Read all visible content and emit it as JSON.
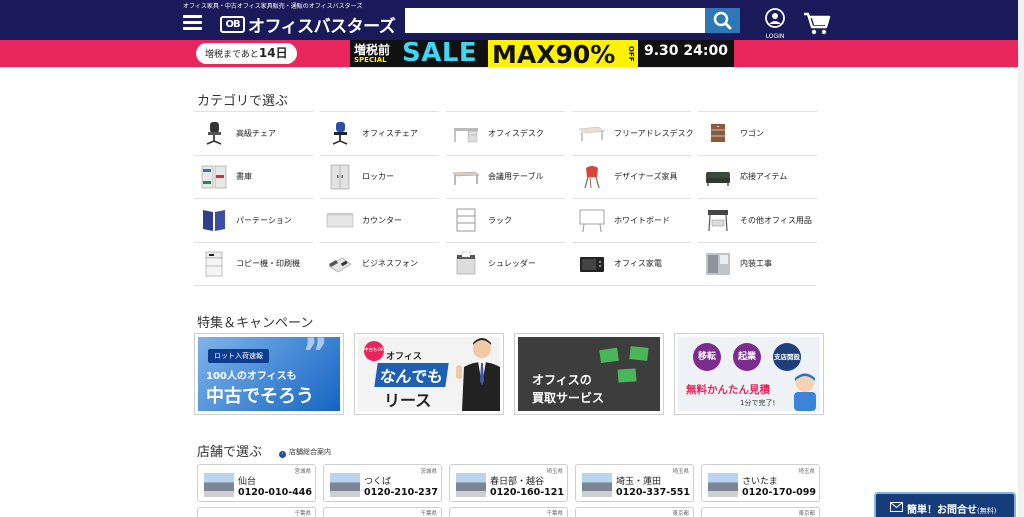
{
  "header": {
    "tagline": "オフィス家具・中古オフィス家具販売・通販のオフィスバスターズ",
    "logo_mark": "OB",
    "logo_text": "オフィスバスターズ",
    "search_placeholder": "",
    "login_label": "LOGIN"
  },
  "banner": {
    "countdown_prefix": "増税まであと",
    "countdown_days": "14日",
    "sale_pre": "増税前",
    "sale_special": "SPECIAL",
    "sale_word": "SALE",
    "sale_max": "MAX90%",
    "sale_off": "OFF",
    "sale_date": "9.30 24:00"
  },
  "categories": {
    "title": "カテゴリで選ぶ",
    "items": [
      {
        "label": "高級チェア",
        "icon": "chair-icon"
      },
      {
        "label": "オフィスチェア",
        "icon": "office-chair-icon"
      },
      {
        "label": "オフィスデスク",
        "icon": "desk-icon"
      },
      {
        "label": "フリーアドレスデスク",
        "icon": "free-address-desk-icon"
      },
      {
        "label": "ワゴン",
        "icon": "wagon-icon"
      },
      {
        "label": "書庫",
        "icon": "bookcase-icon"
      },
      {
        "label": "ロッカー",
        "icon": "locker-icon"
      },
      {
        "label": "会議用テーブル",
        "icon": "meeting-table-icon"
      },
      {
        "label": "デザイナーズ家具",
        "icon": "designer-chair-icon"
      },
      {
        "label": "応接アイテム",
        "icon": "sofa-icon"
      },
      {
        "label": "パーテーション",
        "icon": "partition-icon"
      },
      {
        "label": "カウンター",
        "icon": "counter-icon"
      },
      {
        "label": "ラック",
        "icon": "rack-icon"
      },
      {
        "label": "ホワイトボード",
        "icon": "whiteboard-icon"
      },
      {
        "label": "その他オフィス用品",
        "icon": "other-supplies-icon"
      },
      {
        "label": "コピー機・印刷機",
        "icon": "copier-icon"
      },
      {
        "label": "ビジネスフォン",
        "icon": "business-phone-icon"
      },
      {
        "label": "シュレッダー",
        "icon": "shredder-icon"
      },
      {
        "label": "オフィス家電",
        "icon": "appliance-icon"
      },
      {
        "label": "内装工事",
        "icon": "interior-work-icon"
      }
    ]
  },
  "campaigns": {
    "title": "特集＆キャンペーン",
    "c1": {
      "badge": "ロット入荷速報",
      "line1": "100人のオフィスも",
      "line2": "中古でそろう"
    },
    "c2": {
      "badge": "中古もOK!",
      "line1": "オフィス",
      "line2": "なんでも",
      "line3": "リース"
    },
    "c3": {
      "line1": "オフィスの",
      "line2": "買取サービス"
    },
    "c4": {
      "b1": "移転",
      "b2": "起業",
      "b3": "支店開設",
      "line1": "無料かんたん見積",
      "line2": "1分で完了!"
    }
  },
  "stores": {
    "title": "店舗で選ぶ",
    "guide_link": "店舗総合案内",
    "items": [
      {
        "pref": "宮城県",
        "name": "仙台",
        "phone": "0120-010-446"
      },
      {
        "pref": "茨城県",
        "name": "つくば",
        "phone": "0120-210-237"
      },
      {
        "pref": "埼玉県",
        "name": "春日部・越谷",
        "phone": "0120-160-121"
      },
      {
        "pref": "埼玉県",
        "name": "埼玉・蓮田",
        "phone": "0120-337-551"
      },
      {
        "pref": "埼玉県",
        "name": "さいたま",
        "phone": "0120-170-099"
      }
    ],
    "row2_prefs": [
      "千葉県",
      "千葉県",
      "千葉県",
      "東京都",
      "東京都"
    ]
  },
  "contact": {
    "label": "簡単！お問合せ",
    "free": "(無料)"
  },
  "colors": {
    "header_bg": "#1a1a5a",
    "banner_bg": "#e8265c",
    "search_btn": "#2e78b8",
    "sale_cyan": "#3fd6f2",
    "sale_yellow": "#fff200"
  }
}
